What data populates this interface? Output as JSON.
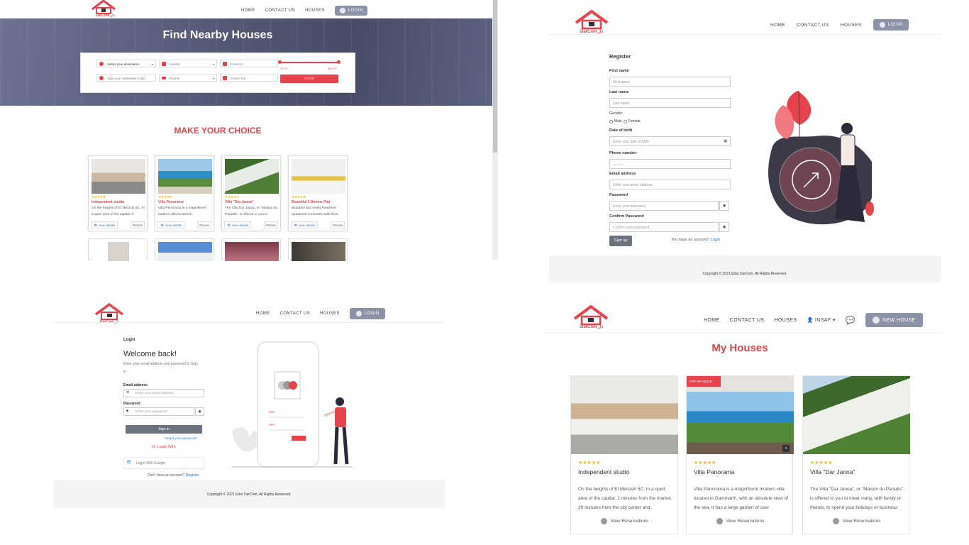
{
  "brand": {
    "name": "DarCom دار",
    "accent": "#e8434d"
  },
  "nav": {
    "home": "HOME",
    "contact": "CONTACT US",
    "houses": "HOUSES",
    "login": "LOGIN",
    "user": "INSAF",
    "new_house": "NEW HOUSE"
  },
  "search": {
    "title": "Find Nearby Houses",
    "destination_select": "Select your destination",
    "destination_placeholder": "Type your destination (city)",
    "guests": "Guests",
    "rooms": "Rooms",
    "checkin": "Check In",
    "checkout": "Check Out",
    "price_min": "20 DT",
    "price_max": "500 DT",
    "filter": "FILTER"
  },
  "choice": {
    "title": "MAKE YOUR CHOICE",
    "view_details": "view details",
    "picture": "Picture",
    "cards": [
      {
        "stars": "★★★★★",
        "title": "Independent studio",
        "desc": "On the heights of El Menzah 5C. In a quiet area of the capital. 2"
      },
      {
        "stars": "★★★★★",
        "title": "Villa Panorama",
        "desc": "Villa Panorama is a magnificent modern villa located in"
      },
      {
        "stars": "★★★★★",
        "title": "Villa \"Dar Janna\"",
        "desc": "The Villa Dar Janna, or \"Maison du Paradis\", is offered to you to"
      },
      {
        "stars": "★★★★★",
        "title": "Beautiful 3 Rooms Flat",
        "desc": "Beautiful and newly furnished apartment 3 minutes walk from"
      }
    ]
  },
  "register": {
    "title": "Register",
    "first_name": "First name",
    "first_name_ph": "First name",
    "last_name": "Last name",
    "last_name_ph": "Last name",
    "gender": "Gender",
    "male": "Male",
    "female": "Female",
    "dob": "Date of birth",
    "dob_ph": "Enter your date of birth",
    "phone": "Phone number",
    "phone_ph": "--------",
    "email": "Email address",
    "email_ph": "Enter your email address",
    "password": "Password",
    "password_ph": "Enter your password",
    "confirm": "Confirm Password",
    "confirm_ph": "Confirm your password",
    "signup": "Sign up",
    "have_account": "You have an account?",
    "login_link": "Login",
    "copyright": "Copyright © 2021 Edar DarCom. All Rights Reserved."
  },
  "login": {
    "label": "Login",
    "welcome": "Welcome back!",
    "sub": "Enter your email address and password to Sign in",
    "email": "Email address",
    "email_ph": "Enter your email address",
    "password": "Password",
    "password_ph": "Enter your password",
    "signin": "Sign in",
    "forgot": "Forgot your password?",
    "or": "Or Login With",
    "google": "Login With Google",
    "no_account": "Don't have an account?",
    "register_link": "Register",
    "copyright": "Copyright © 2021 Edar DarCom. All Rights Reserved."
  },
  "my_houses": {
    "title": "My Houses",
    "badge": "TOP OF ABOUT",
    "view": "View Reservations",
    "cards": [
      {
        "stars": "★★★★★",
        "title": "Independent studio",
        "desc": "On the heights of El Menzah 5C. In a quiet area of the capital. 2 minutes from the market. 20 minutes from the city center and"
      },
      {
        "stars": "★★★★★",
        "title": "Villa Panorama",
        "desc": "Villa Panorama is a magnificent modern villa located in Gammarth, with an absolute view of the sea. It has a large garden of over"
      },
      {
        "stars": "★★★★★",
        "title": "Villa \"Dar Janna\"",
        "desc": "The Villa \"Dar Janna\", or \"Maison du Paradis\", is offered to you to meet many, with family or friends, to spend your holidays or business"
      }
    ]
  }
}
